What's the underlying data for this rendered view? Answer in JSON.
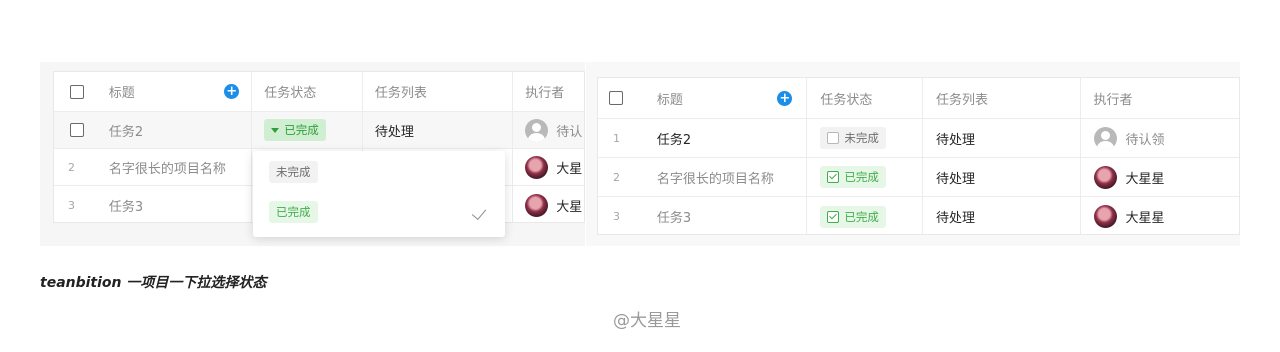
{
  "left_table": {
    "header": {
      "title": "标题",
      "status": "任务状态",
      "list": "任务列表",
      "assignee": "执行者"
    },
    "rows": [
      {
        "index": "",
        "title": "任务2",
        "status": "已完成",
        "list": "待处理",
        "assignee": "待认"
      },
      {
        "index": "2",
        "title": "名字很长的项目名称",
        "assignee": "大星"
      },
      {
        "index": "3",
        "title": "任务3",
        "assignee": "大星"
      }
    ],
    "dropdown": {
      "options": [
        "未完成",
        "已完成"
      ],
      "selected": "已完成"
    }
  },
  "right_table": {
    "header": {
      "title": "标题",
      "status": "任务状态",
      "list": "任务列表",
      "assignee": "执行者"
    },
    "rows": [
      {
        "index": "1",
        "title": "任务2",
        "status": "未完成",
        "list": "待处理",
        "assignee": "待认领"
      },
      {
        "index": "2",
        "title": "名字很长的项目名称",
        "status": "已完成",
        "list": "待处理",
        "assignee": "大星星"
      },
      {
        "index": "3",
        "title": "任务3",
        "status": "已完成",
        "list": "待处理",
        "assignee": "大星星"
      }
    ]
  },
  "caption": "teanbition 一项目一下拉选择状态",
  "watermark": "@大星星",
  "colors": {
    "accent_blue": "#1b8fe8",
    "done_green": "#3fae49",
    "done_bg": "#e6f6e7"
  },
  "icons": [
    "plus-circle-icon",
    "caret-down-icon",
    "checkmark-icon",
    "avatar-placeholder-icon"
  ]
}
